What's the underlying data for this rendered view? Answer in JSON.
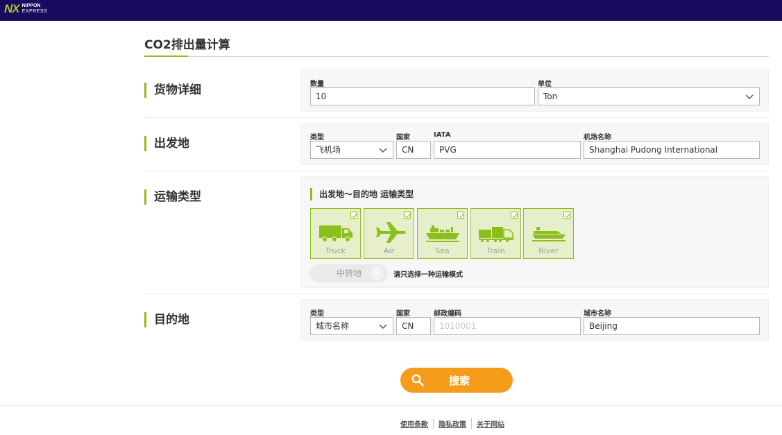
{
  "brand": {
    "mark": "NX",
    "line1": "NIPPON",
    "line2": "EXPRESS"
  },
  "page": {
    "title": "CO2排出量计算"
  },
  "cargo": {
    "label": "货物详细",
    "quantity_label": "数量",
    "quantity_value": "10",
    "unit_label": "单位",
    "unit_value": "Ton"
  },
  "origin": {
    "label": "出发地",
    "type_label": "类型",
    "type_value": "飞机场",
    "country_label": "国家",
    "country_value": "CN",
    "iata_label": "IATA",
    "iata_value": "PVG",
    "airport_label": "机场名称",
    "airport_value": "Shanghai Pudong International"
  },
  "transport": {
    "label": "运输类型",
    "subtitle": "出发地～目的地 运输类型",
    "modes": [
      {
        "label": "Truck",
        "icon": "truck-icon",
        "checked": true
      },
      {
        "label": "Air",
        "icon": "airplane-icon",
        "checked": true
      },
      {
        "label": "Sea",
        "icon": "ship-icon",
        "checked": true
      },
      {
        "label": "Train",
        "icon": "train-icon",
        "checked": true
      },
      {
        "label": "River",
        "icon": "river-boat-icon",
        "checked": true
      }
    ],
    "transit_label": "中转地",
    "note": "请只选择一种运输模式"
  },
  "destination": {
    "label": "目的地",
    "type_label": "类型",
    "type_value": "城市名称",
    "country_label": "国家",
    "country_value": "CN",
    "postal_label": "邮政编码",
    "postal_placeholder": "1010001",
    "city_label": "城市名称",
    "city_value": "Beijing"
  },
  "search": {
    "label": "搜索"
  },
  "footer": {
    "links": [
      "使用条款",
      "隐私政策",
      "关于网站"
    ]
  },
  "colors": {
    "header": "#1a0a5e",
    "accent": "#8cbe1d",
    "button": "#f59c1b"
  }
}
